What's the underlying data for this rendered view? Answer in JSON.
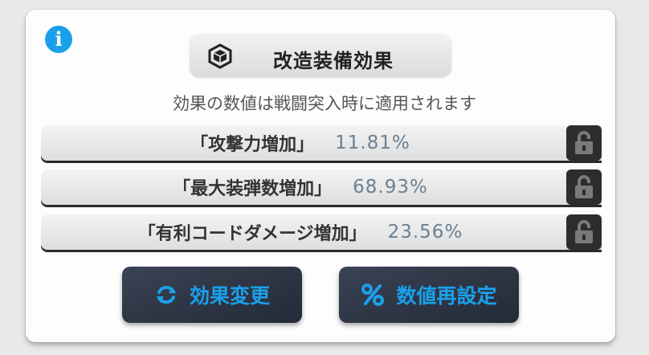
{
  "dialog": {
    "info_icon": "info-icon",
    "title": "改造装備効果",
    "title_icon": "cube-icon",
    "subtitle": "効果の数値は戦闘突入時に適用されます"
  },
  "effects": [
    {
      "name": "「攻撃力増加」",
      "value": "11.81%",
      "lock_icon": "unlocked-padlock-icon"
    },
    {
      "name": "「最大装弾数増加」",
      "value": "68.93%",
      "lock_icon": "unlocked-padlock-icon"
    },
    {
      "name": "「有利コードダメージ増加」",
      "value": "23.56%",
      "lock_icon": "unlocked-padlock-icon"
    }
  ],
  "buttons": {
    "change_effect": "効果変更",
    "change_effect_icon": "refresh-icon",
    "reset_values": "数値再設定",
    "reset_values_icon": "percent-icon"
  },
  "colors": {
    "accent": "#1aa0ea",
    "value_text": "#6a7f92",
    "button_bg": "#2c3444",
    "lock_bg": "#2d2d2d"
  }
}
